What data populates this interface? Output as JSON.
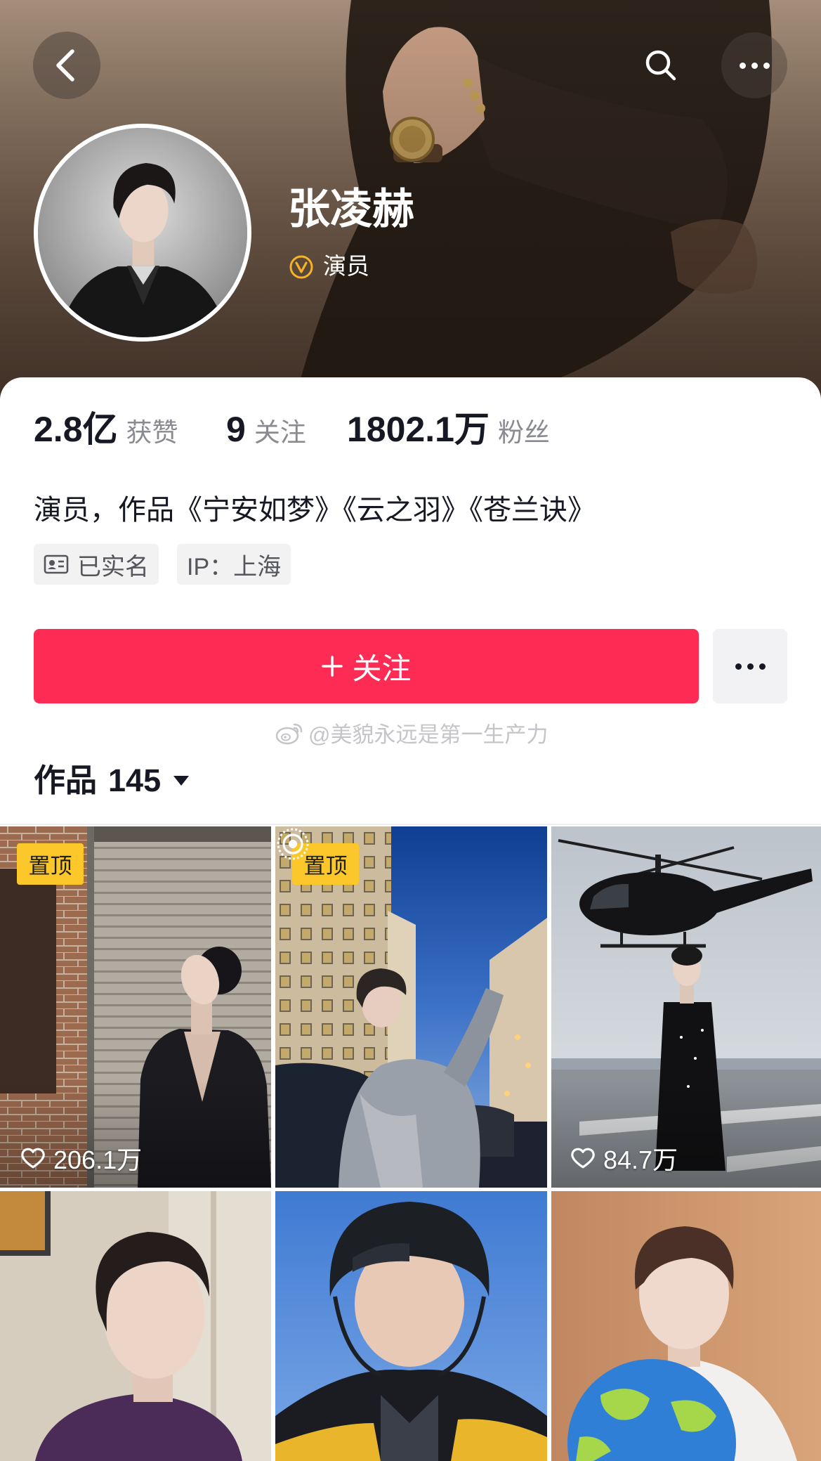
{
  "nav": {
    "back_icon": "chevron-left-icon",
    "search_icon": "search-icon",
    "more_icon": "more-horizontal-icon"
  },
  "profile": {
    "name": "张凌赫",
    "verified": {
      "icon": "verified-v-icon",
      "label": "演员"
    },
    "stats": [
      {
        "value": "2.8亿",
        "label": "获赞"
      },
      {
        "value": "9",
        "label": "关注"
      },
      {
        "value": "1802.1万",
        "label": "粉丝"
      }
    ],
    "bio": "演员，作品《宁安如梦》《云之羽》《苍兰诀》",
    "tags": [
      {
        "icon": "id-card-icon",
        "label": "已实名"
      },
      {
        "label": "IP：上海"
      }
    ]
  },
  "actions": {
    "follow": {
      "icon": "plus-icon",
      "label": "关注"
    },
    "more_icon": "more-horizontal-icon"
  },
  "watermark": {
    "icon": "weibo-icon",
    "text": "@美貌永远是第一生产力"
  },
  "works": {
    "label": "作品",
    "count": "145",
    "dropdown_icon": "caret-down-icon"
  },
  "videos": [
    {
      "pinned": true,
      "pinned_label": "置顶",
      "likes": "206.1万",
      "heart_icon": "heart-outline-icon"
    },
    {
      "pinned": true,
      "pinned_label": "置顶",
      "badge_icon": "live-photo-icon"
    },
    {
      "pinned": false,
      "likes": "84.7万",
      "heart_icon": "heart-outline-icon"
    },
    {
      "pinned": false
    },
    {
      "pinned": false
    },
    {
      "pinned": false
    }
  ],
  "colors": {
    "accent": "#fe2c55",
    "pin": "#fbc72b",
    "text": "#161823",
    "muted": "#8a8b91",
    "tagbg": "#f2f2f3",
    "verified": "#f5b325"
  }
}
